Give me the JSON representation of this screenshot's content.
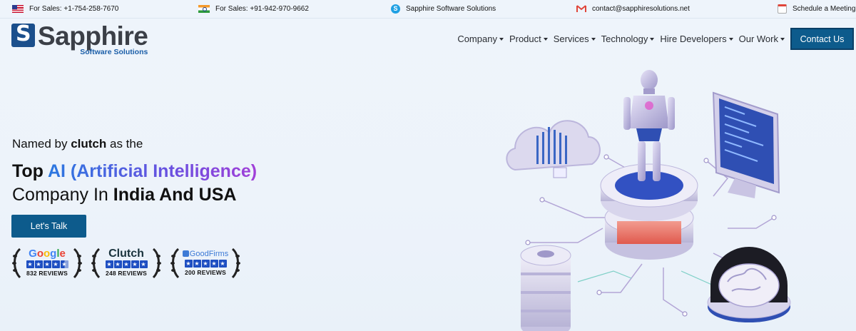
{
  "topbar": {
    "sales_us": "For Sales: +1-754-258-7670",
    "sales_in": "For Sales: +91-942-970-9662",
    "skype": "Sapphire Software Solutions",
    "email": "contact@sapphiresolutions.net",
    "schedule": "Schedule a Meeting"
  },
  "logo": {
    "mark": "S",
    "name": "Sapphire",
    "tagline": "Software Solutions"
  },
  "nav": {
    "items": [
      {
        "label": "Company"
      },
      {
        "label": "Product"
      },
      {
        "label": "Services"
      },
      {
        "label": "Technology"
      },
      {
        "label": "Hire Developers"
      },
      {
        "label": "Our Work"
      }
    ],
    "contact_label": "Contact Us"
  },
  "hero": {
    "named_pre": "Named by ",
    "named_brand": "clutch",
    "named_post": " as the",
    "line1_pre": "Top ",
    "line1_highlight": "AI (Artificial Intelligence)",
    "line2_pre": "Company In ",
    "line2_bold": "India And USA",
    "cta_label": "Let's Talk"
  },
  "badges": [
    {
      "brand": "Google",
      "reviews": "832 REVIEWS",
      "rating": 4.5,
      "icon": "google-logo"
    },
    {
      "brand": "Clutch",
      "reviews": "248 REVIEWS",
      "rating": 5,
      "icon": "clutch-logo"
    },
    {
      "brand": "GoodFirms",
      "reviews": "200 REVIEWS",
      "rating": 5,
      "icon": "goodfirms-logo"
    }
  ],
  "colors": {
    "primary": "#0d5b8c",
    "logo_blue": "#1b4f8c",
    "star_blue": "#1e4fc2",
    "gradient_start": "#2a78e0",
    "gradient_end": "#a23fd8"
  },
  "illustration": {
    "icon": "ai-robot-illustration"
  }
}
